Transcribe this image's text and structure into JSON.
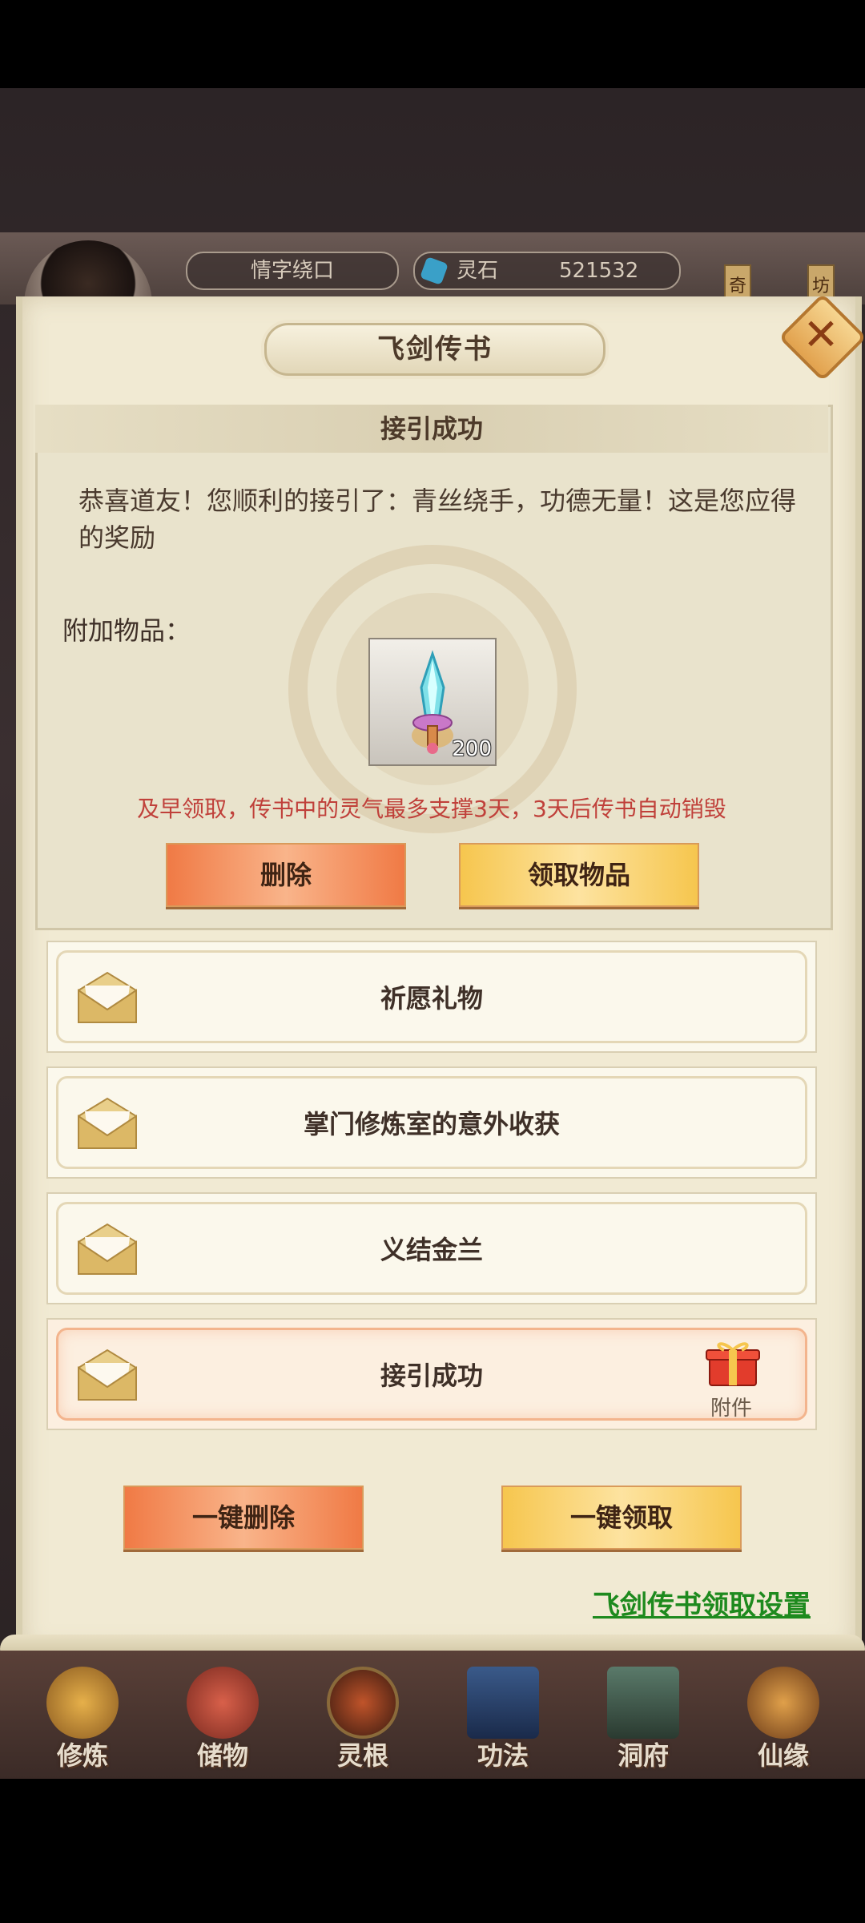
{
  "header": {
    "player_name": "情字绕口",
    "currency_label": "灵石",
    "currency_value": "521532",
    "side_tags": [
      "奇",
      "坊"
    ]
  },
  "panel": {
    "title": "飞剑传书"
  },
  "detail": {
    "heading": "接引成功",
    "message": "恭喜道友！您顺利的接引了：青丝绕手，功德无量！这是您应得的奖励",
    "attachment_label": "附加物品：",
    "item_count": "200",
    "warning": "及早领取，传书中的灵气最多支撑3天，3天后传书自动销毁",
    "delete_label": "删除",
    "claim_label": "领取物品"
  },
  "mails": [
    {
      "title": "祈愿礼物"
    },
    {
      "title": "掌门修炼室的意外收获"
    },
    {
      "title": "义结金兰"
    },
    {
      "title": "接引成功",
      "attachment": "附件"
    }
  ],
  "actions": {
    "delete_all_label": "一键删除",
    "claim_all_label": "一键领取",
    "settings_link": "飞剑传书领取设置"
  },
  "nav": [
    {
      "label": "修炼"
    },
    {
      "label": "储物"
    },
    {
      "label": "灵根"
    },
    {
      "label": "功法"
    },
    {
      "label": "洞府"
    },
    {
      "label": "仙缘"
    }
  ],
  "colors": {
    "warning": "#c0403a",
    "link": "#1e8a1e",
    "delete_button": "#f07a45",
    "claim_button": "#f6c64e"
  }
}
